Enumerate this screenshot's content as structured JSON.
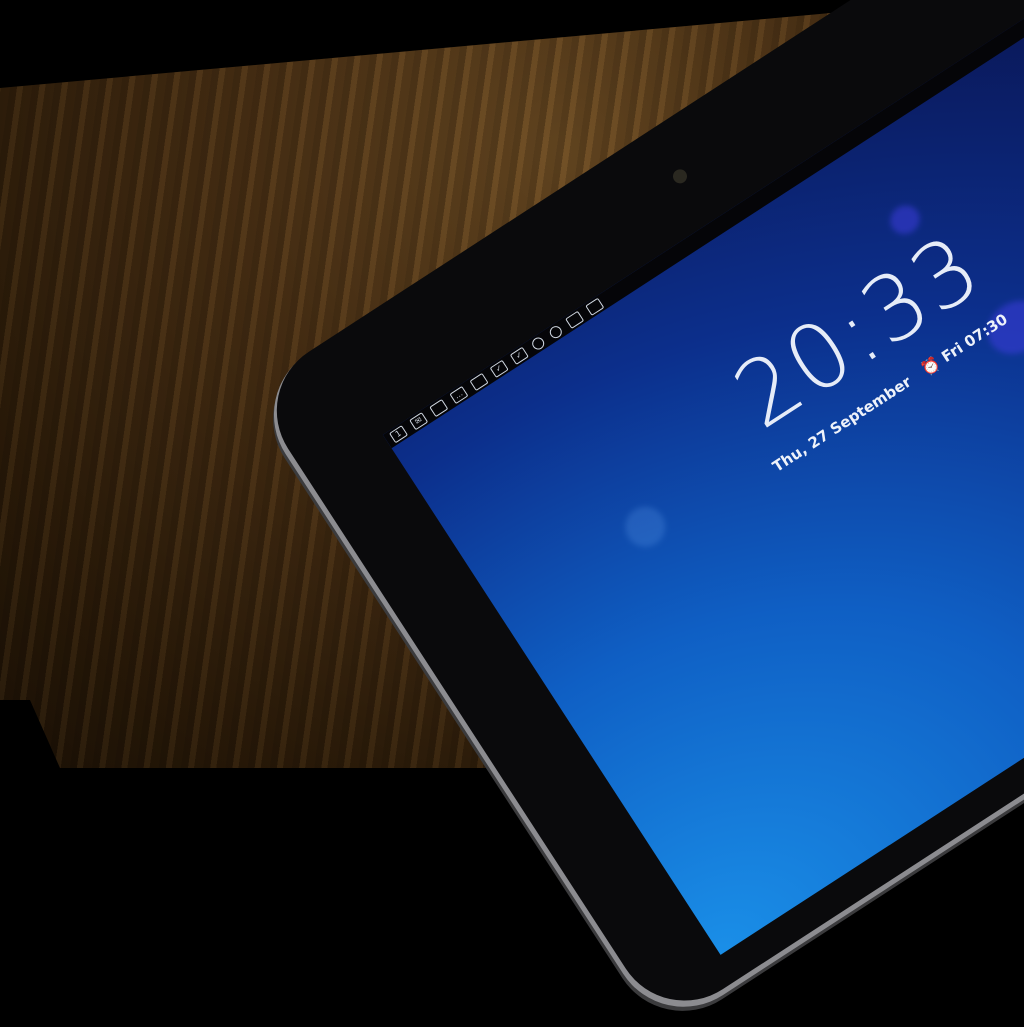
{
  "lockscreen": {
    "time": "20:33",
    "date": "Thu, 27 September",
    "alarm_icon": "alarm-clock-icon",
    "alarm": "Fri 07:30"
  },
  "status_bar": {
    "icons": [
      "calendar-icon",
      "gmail-icon",
      "notification-icon",
      "chat-icon",
      "notification-icon",
      "checkbox-icon",
      "checkbox-icon",
      "clock-icon",
      "alarm-icon",
      "notification-icon",
      "notification-icon"
    ]
  },
  "colors": {
    "screen": "#0f5fc4",
    "wood": "#4a3014",
    "bezel": "#0a0a0c"
  }
}
